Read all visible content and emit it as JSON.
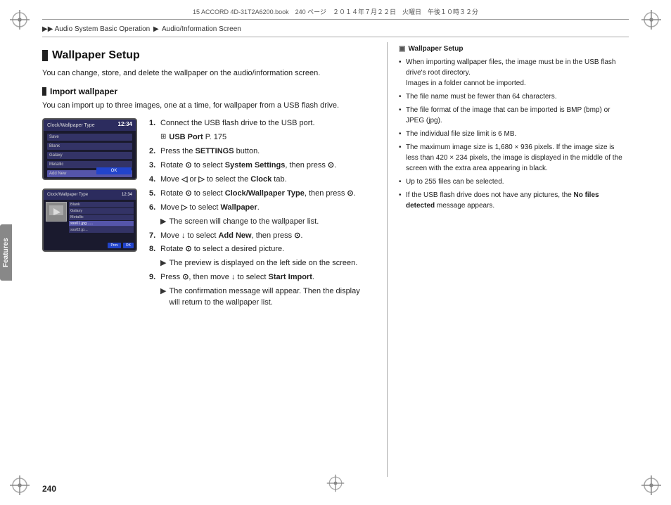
{
  "meta": {
    "file_info": "15 ACCORD 4D-31T2A6200.book　240 ページ　２０１４年７月２２日　火曜日　午後１０時３２分"
  },
  "breadcrumb": {
    "parts": [
      "Audio System Basic Operation",
      "Audio/Information Screen"
    ]
  },
  "section": {
    "title": "Wallpaper Setup",
    "intro": "You can change, store, and delete the wallpaper on the audio/information screen.",
    "sub_title": "Import wallpaper",
    "sub_intro": "You can import up to three images, one at a time, for wallpaper from a USB flash drive."
  },
  "steps": [
    {
      "num": "1.",
      "text": "Connect the USB flash drive to the USB port.",
      "sub": "⊞ USB Port P. 175"
    },
    {
      "num": "2.",
      "text": "Press the SETTINGS button."
    },
    {
      "num": "3.",
      "text": "Rotate ⊙ to select System Settings, then press ⊙."
    },
    {
      "num": "4.",
      "text": "Move ◁ or ▷ to select the Clock tab."
    },
    {
      "num": "5.",
      "text": "Rotate ⊙ to select Clock/Wallpaper Type, then press ⊙."
    },
    {
      "num": "6.",
      "text": "Move ▷ to select Wallpaper.",
      "sub": "▶ The screen will change to the wallpaper list."
    },
    {
      "num": "7.",
      "text": "Move ↓ to select Add New, then press ⊙."
    },
    {
      "num": "8.",
      "text": "Rotate ⊙ to select a desired picture.",
      "sub": "▶ The preview is displayed on the left side on the screen."
    },
    {
      "num": "9.",
      "text": "Press ⊙, then move ↓ to select Start Import.",
      "sub": "▶ The confirmation message will appear. Then the display will return to the wallpaper list."
    }
  ],
  "screen1": {
    "title": "Clock/Wallpaper Type",
    "time": "12:34",
    "rows": [
      "Save",
      "Blank",
      "Galaxy",
      "Metallic",
      "Add New"
    ],
    "highlighted": "Add New",
    "button": "OK"
  },
  "screen2": {
    "title": "Clock/Wallpaper Type",
    "time": "12:34",
    "list": [
      "Blank",
      "Galaxy",
      "Metallic",
      "sss01.jpg .....",
      "sss02.jp..."
    ],
    "selected": "sss01.jpg .....",
    "buttons": [
      "Prev",
      "OK"
    ]
  },
  "right_col": {
    "title": "Wallpaper Setup",
    "bullets": [
      "When importing wallpaper files, the image must be in the USB flash drive's root directory. Images in a folder cannot be imported.",
      "The file name must be fewer than 64 characters.",
      "The file format of the image that can be imported is BMP (bmp) or JPEG (jpg).",
      "The individual file size limit is 6 MB.",
      "The maximum image size is 1,680 × 936 pixels. If the image size is less than 420 × 234 pixels, the image is displayed in the middle of the screen with the extra area appearing in black.",
      "Up to 255 files can be selected.",
      "If the USB flash drive does not have any pictures, the No files detected message appears."
    ]
  },
  "page_number": "240",
  "features_label": "Features"
}
